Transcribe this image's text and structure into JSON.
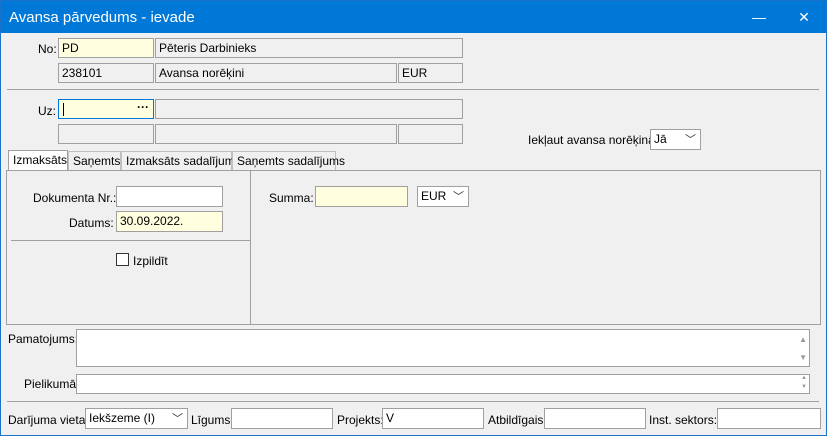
{
  "window": {
    "title": "Avansa pārvedums - ievade",
    "minimize": "—",
    "close": "✕"
  },
  "header": {
    "no_label": "No:",
    "no_code": "PD",
    "no_name": "Pēteris Darbinieks",
    "account_code": "238101",
    "account_name": "Avansa norēķini",
    "currency": "EUR"
  },
  "uz": {
    "label": "Uz:",
    "value": "",
    "ellipsis": "···",
    "include_label": "Iekļaut avansa norēķinā",
    "include_value": "Jā"
  },
  "tabs": [
    {
      "label": "Izmaksāts",
      "active": true
    },
    {
      "label": "Saņemts"
    },
    {
      "label": "Izmaksāts sadalījums"
    },
    {
      "label": "Saņemts sadalījums"
    }
  ],
  "panel": {
    "doc_nr_label": "Dokumenta Nr.:",
    "doc_nr_value": "",
    "date_label": "Datums:",
    "date_value": "30.09.2022.",
    "sum_label": "Summa:",
    "sum_value": "",
    "sum_currency": "EUR",
    "executed_label": "Izpildīt",
    "executed_checked": false
  },
  "pamatojums": {
    "label": "Pamatojums:",
    "value": ""
  },
  "pielikuma": {
    "label": "Pielikumā:",
    "value": ""
  },
  "footer": {
    "place_label": "Darījuma vieta:",
    "place_value": "Iekšzeme (I)",
    "contract_label": "Līgums:",
    "contract_value": "",
    "project_label": "Projekts:",
    "project_value": "V",
    "responsible_label": "Atbildīgais:",
    "responsible_value": "",
    "sector_label": "Inst. sektors:",
    "sector_value": ""
  },
  "icons": {
    "dropdown": "chevron-down-icon",
    "scroll_up": "scroll-up-icon",
    "scroll_down": "scroll-down-icon"
  }
}
